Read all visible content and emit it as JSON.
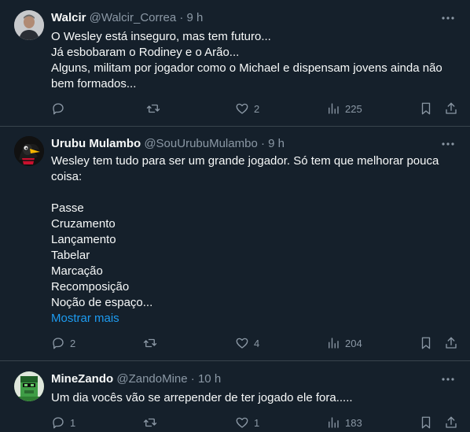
{
  "tweets": [
    {
      "name": "Walcir",
      "handle": "@Walcir_Correa",
      "dot": "·",
      "time": "9 h",
      "avatar_icon": "person-photo",
      "lines": [
        "O Wesley está inseguro, mas tem futuro...",
        "Já esbobaram o Rodiney e o Arão...",
        "Alguns, militam por jogador como o Michael e dispensam jovens ainda não",
        "bem formados..."
      ],
      "show_more": "",
      "counts": {
        "replies": "",
        "retweets": "",
        "likes": "2",
        "views": "225"
      }
    },
    {
      "name": "Urubu Mulambo",
      "handle": "@SouUrubuMulambo",
      "dot": "·",
      "time": "9 h",
      "avatar_icon": "vulture-mascot",
      "lines": [
        "Wesley tem tudo para ser um grande jogador. Só tem que melhorar pouca",
        "coisa:",
        "",
        "Passe",
        "Cruzamento",
        "Lançamento",
        "Tabelar",
        "Marcação",
        "Recomposição",
        "Noção de espaço..."
      ],
      "show_more": "Mostrar mais",
      "counts": {
        "replies": "2",
        "retweets": "",
        "likes": "4",
        "views": "204"
      }
    },
    {
      "name": "MineZando",
      "handle": "@ZandoMine",
      "dot": "·",
      "time": "10 h",
      "avatar_icon": "pixel-character",
      "lines": [
        "Um dia vocês vão se arrepender de ter jogado ele fora....."
      ],
      "show_more": "",
      "counts": {
        "replies": "1",
        "retweets": "",
        "likes": "1",
        "views": "183"
      }
    }
  ],
  "colors": {
    "background": "#15202b",
    "text": "#f7f9f9",
    "muted": "#8b98a5",
    "link": "#1d9bf0",
    "divider": "#38444d"
  }
}
